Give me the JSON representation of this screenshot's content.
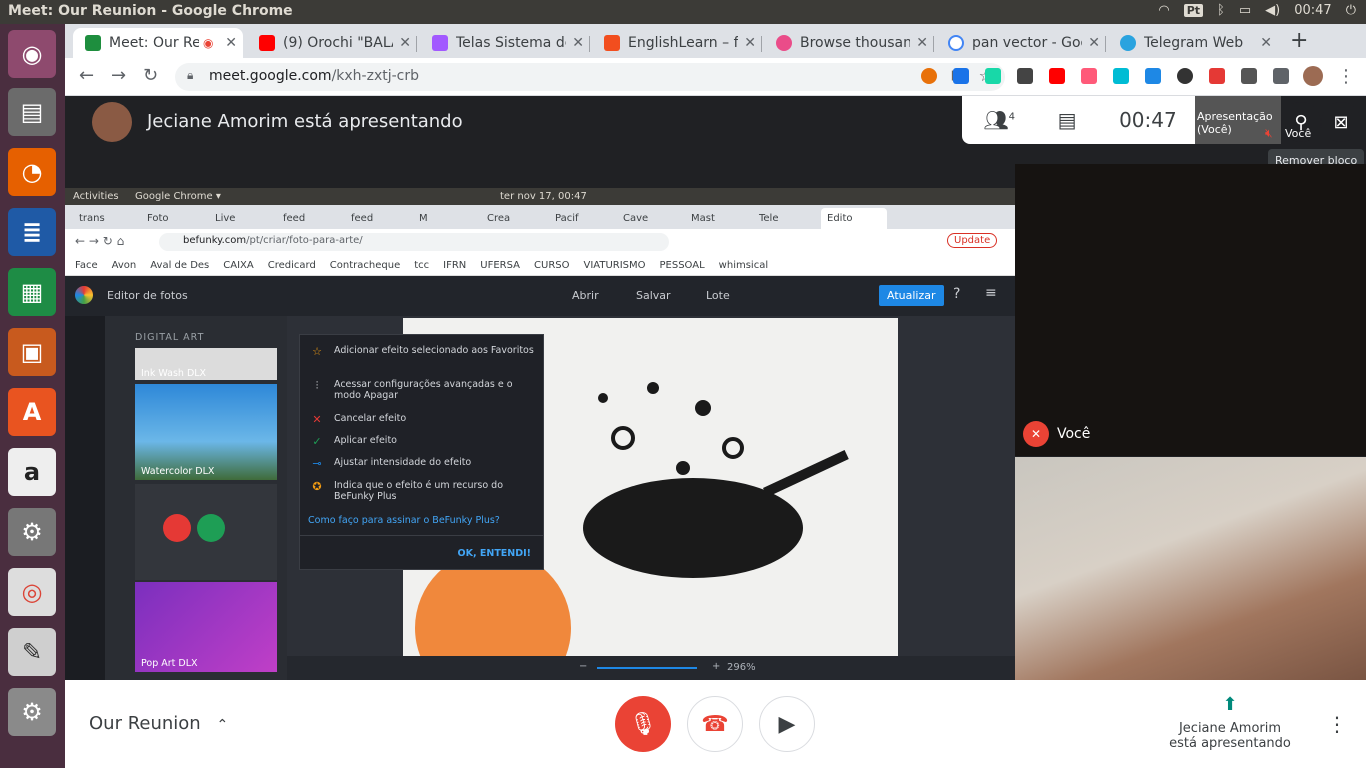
{
  "os": {
    "window_title": "Meet: Our Reunion - Google Chrome",
    "time": "00:47",
    "indicator_pt": "Pt"
  },
  "browser": {
    "tabs": [
      {
        "label": "Meet: Our Re",
        "color": "#1e8e3e"
      },
      {
        "label": "(9) Orochi \"BALA",
        "color": "#ff0000"
      },
      {
        "label": "Telas Sistema de",
        "color": "#a259ff"
      },
      {
        "label": "EnglishLearn – f",
        "color": "#f24e1e"
      },
      {
        "label": "Browse thousan",
        "color": "#ea4c89"
      },
      {
        "label": "pan vector - Goo",
        "color": "#4285f4"
      },
      {
        "label": "Telegram Web",
        "color": "#2aa3df"
      }
    ],
    "url_host": "meet.google.com",
    "url_path": "/kxh-zxtj-crb"
  },
  "meet": {
    "presenting_text": "Jeciane Amorim está apresentando",
    "participants_count": "4",
    "clock": "00:47",
    "pip_label_presentation": "Apresentação",
    "pip_label_you_paren": "(Você)",
    "pip_label_you": "Você",
    "tooltip": "Remover bloco",
    "tile_you_label": "Você",
    "meeting_name": "Our Reunion",
    "presenter_line1": "Jeciane Amorim",
    "presenter_line2": "está apresentando"
  },
  "shared": {
    "activities": "Activities",
    "app": "Google Chrome ▾",
    "datetime": "ter nov 17, 00:47",
    "tabs": [
      "trans",
      "Foto",
      "Live",
      "feed",
      "feed",
      "M",
      "Crea",
      "Pacif",
      "Cave",
      "Mast",
      "Tele",
      "Edito"
    ],
    "url_host": "befunky.com",
    "url_path": "/pt/criar/foto-para-arte/",
    "update": "Update",
    "bookmarks": [
      "Face",
      "Avon",
      "Aval de Des",
      "CAIXA",
      "Credicard",
      "Contracheque",
      "tcc",
      "IFRN",
      "UFERSA",
      "CURSO",
      "VIATURISMO",
      "PESSOAL",
      "whimsical"
    ],
    "editor_menu": "Editor de fotos",
    "open": "Abrir",
    "save": "Salvar",
    "batch": "Lote",
    "update_btn": "Atualizar",
    "panel_title": "DIGITAL ART",
    "effects": [
      "Ink Wash DLX",
      "Watercolor DLX",
      "Pop Art DLX"
    ],
    "popup_items": [
      "Adicionar efeito selecionado aos Favoritos",
      "Acessar configurações avançadas e o modo Apagar",
      "Cancelar efeito",
      "Aplicar efeito",
      "Ajustar intensidade do efeito",
      "Indica que o efeito é um recurso do BeFunky Plus"
    ],
    "popup_link": "Como faço para assinar o BeFunky Plus?",
    "popup_ok": "OK, ENTENDI!",
    "zoom": "296%"
  }
}
